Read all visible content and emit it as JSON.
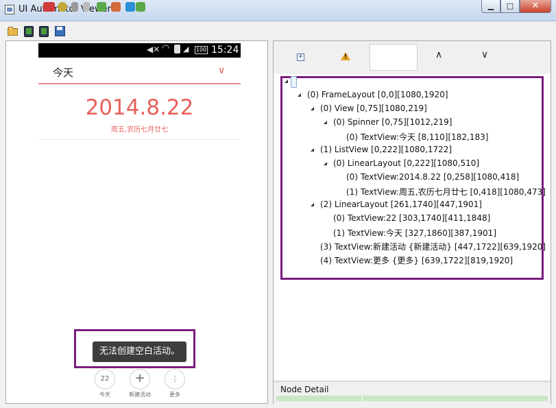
{
  "window": {
    "title": "UI Automator Viewer",
    "controls": {
      "minimize": "▁",
      "maximize": "□",
      "close": "✕"
    }
  },
  "toolbar": {
    "icons": [
      "open-folder-icon",
      "device-screenshot-icon",
      "compressed-screenshot-icon",
      "save-icon"
    ]
  },
  "device": {
    "status_bar": {
      "time": "15:24",
      "battery": "100"
    },
    "spinner_text": "今天",
    "date": "2014.8.22",
    "lunar": "周五,农历七月廿七",
    "toast": "无法创建空白活动。",
    "bottom_nav": [
      {
        "icon_text": "22",
        "label": "今天"
      },
      {
        "icon_text": "+",
        "label": "新建活动"
      },
      {
        "icon_text": "⋮",
        "label": "更多"
      }
    ]
  },
  "tree_toolbar": {
    "nafmode_mark": "!"
  },
  "tree": [
    "(0) FrameLayout [0,0][1080,1920]",
    "(0) View [0,75][1080,219]",
    "(0) Spinner [0,75][1012,219]",
    "(0) TextView:今天 [8,110][182,183]",
    "(1) ListView [0,222][1080,1722]",
    "(0) LinearLayout [0,222][1080,510]",
    "(0) TextView:2014.8.22 [0,258][1080,418]",
    "(1) TextView:周五,农历七月廿七 [0,418][1080,473]",
    "(2) LinearLayout [261,1740][447,1901]",
    "(0) TextView:22 [303,1740][411,1848]",
    "(1) TextView:今天 [327,1860][387,1901]",
    "(3) TextView:新建活动 {新建活动} [447,1722][639,1920]",
    "(4) TextView:更多 {更多} [639,1722][819,1920]"
  ],
  "node_detail": {
    "title": "Node Detail"
  }
}
